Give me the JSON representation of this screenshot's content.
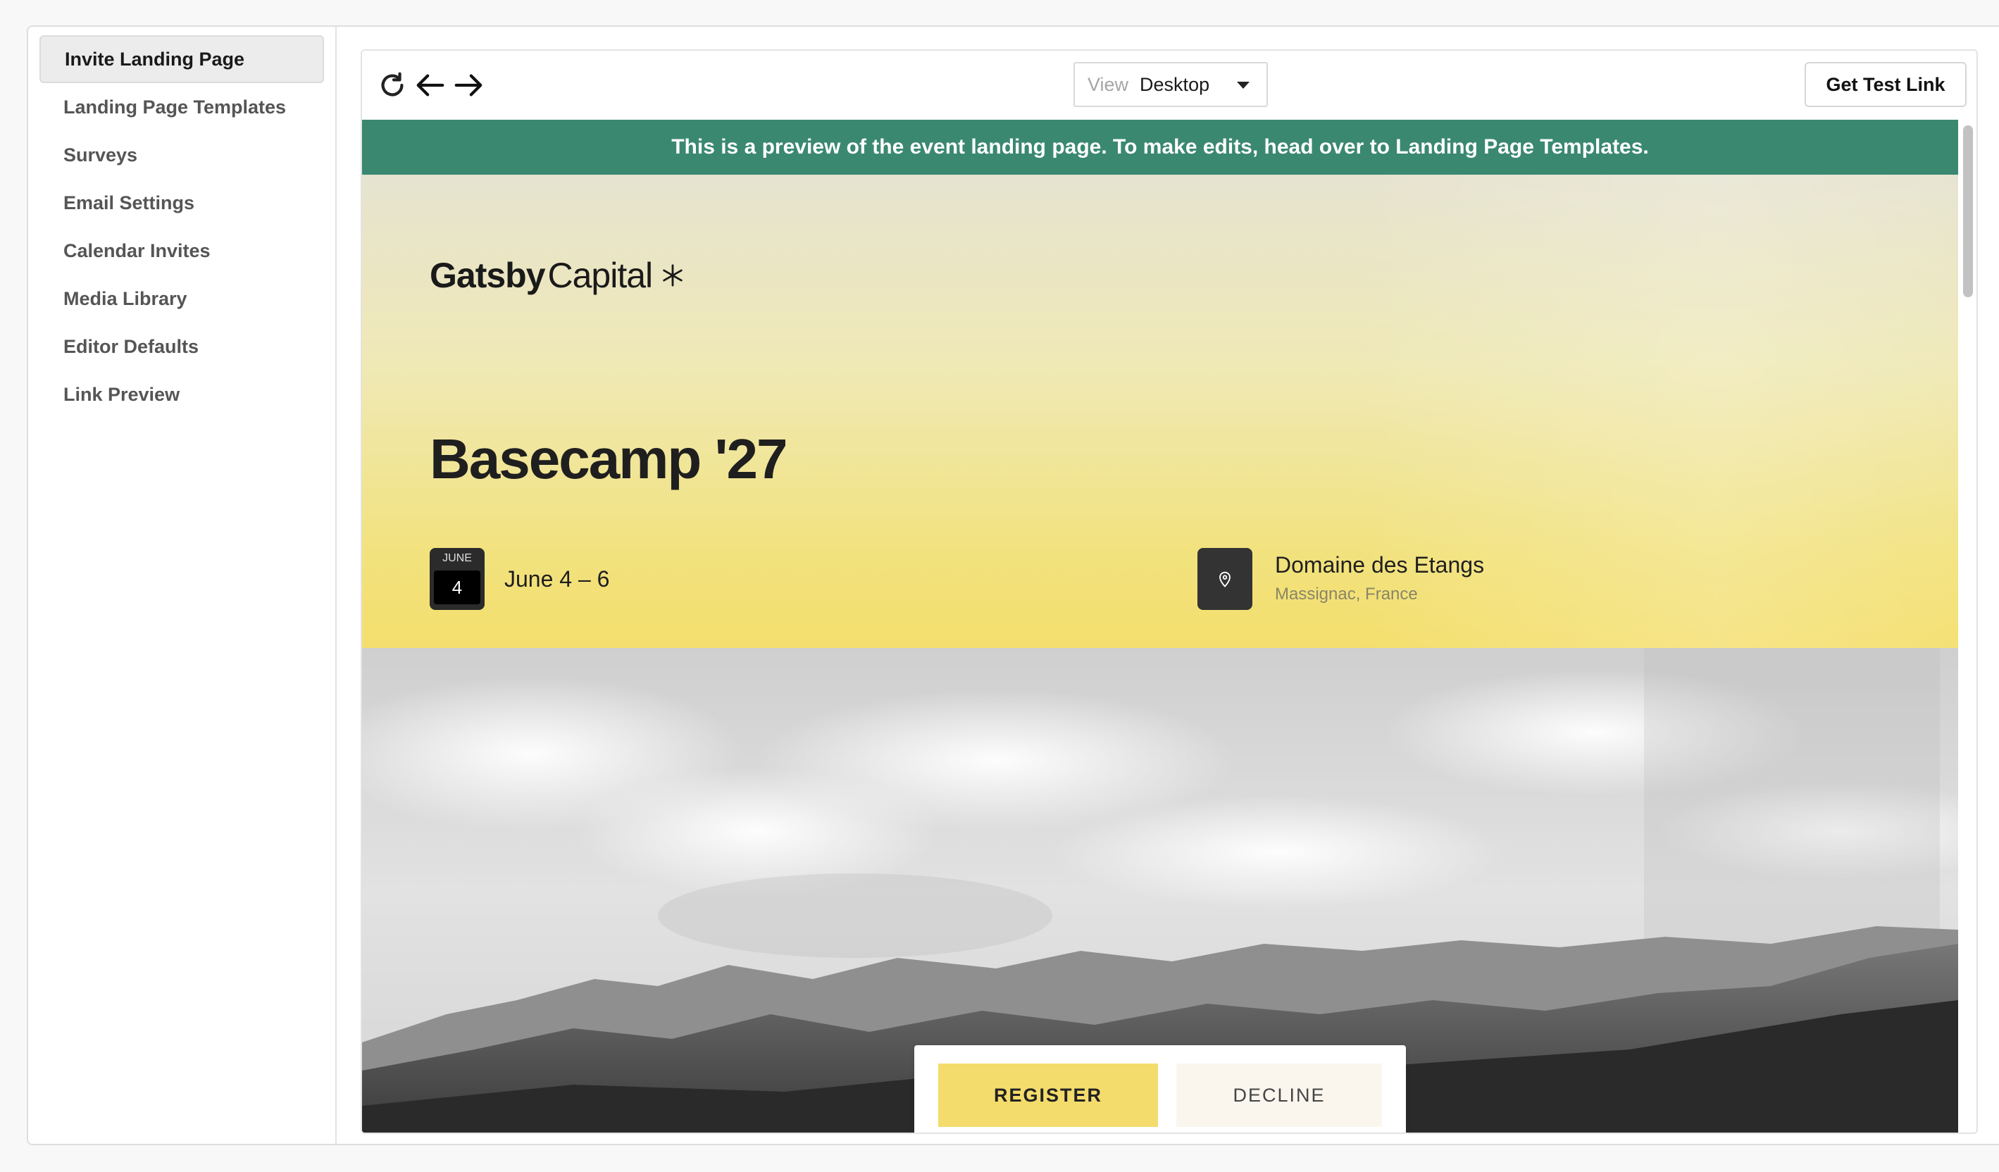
{
  "sidebar": {
    "items": [
      {
        "label": "Invite Landing Page",
        "active": true
      },
      {
        "label": "Landing Page Templates"
      },
      {
        "label": "Surveys"
      },
      {
        "label": "Email Settings"
      },
      {
        "label": "Calendar Invites"
      },
      {
        "label": "Media Library"
      },
      {
        "label": "Editor Defaults"
      },
      {
        "label": "Link Preview"
      }
    ]
  },
  "toolbar": {
    "icons": [
      "refresh-icon",
      "arrow-left-icon",
      "arrow-right-icon"
    ],
    "view_label": "View",
    "view_value": "Desktop",
    "test_link_label": "Get Test Link"
  },
  "preview": {
    "banner": "This is a preview of the event landing page. To make edits, head over to Landing Page Templates.",
    "banner_color": "#3a8870",
    "logo_bold": "Gatsby",
    "logo_light": "Capital",
    "title": "Basecamp '27",
    "calendar_month": "JUNE",
    "calendar_day": "4",
    "date_text": "June 4 – 6",
    "location_name": "Domaine des Etangs",
    "location_sub": "Massignac, France",
    "register_label": "REGISTER",
    "decline_label": "DECLINE",
    "accent_color": "#f4dc6c"
  }
}
